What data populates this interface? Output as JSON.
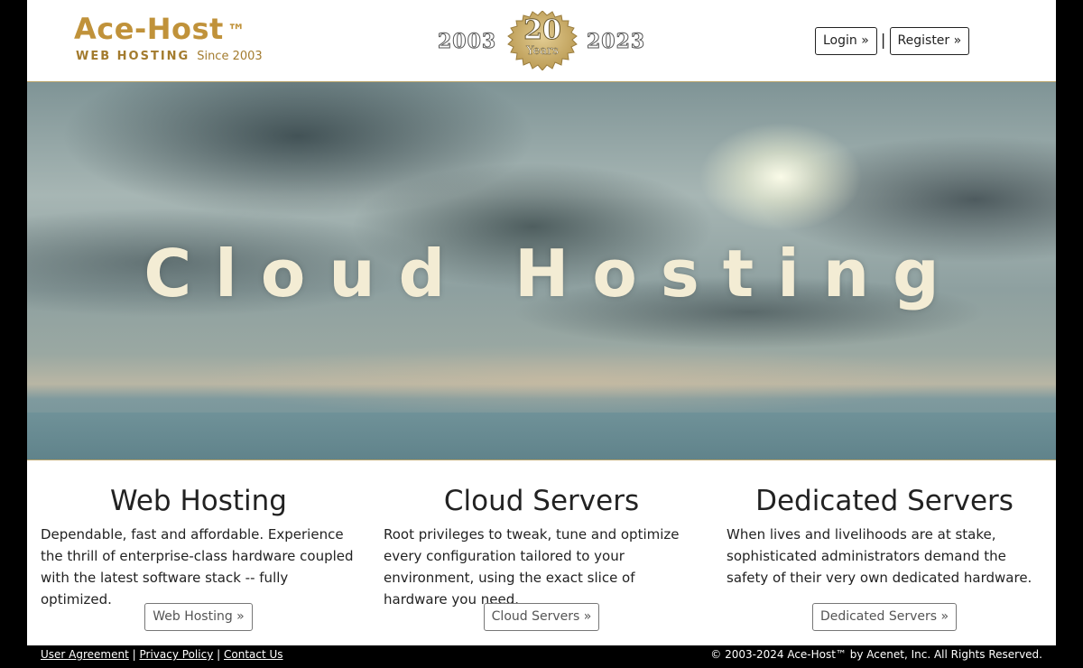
{
  "header": {
    "logo_title": "Ace-Host",
    "logo_tm": "™",
    "logo_tagline": "WEB HOSTING",
    "logo_since": "Since 2003",
    "anniversary": {
      "year_start": "2003",
      "year_end": "2023",
      "seal_number": "20",
      "seal_label": "Years"
    },
    "login_label": "Login »",
    "separator": "|",
    "register_label": "Register »"
  },
  "hero": {
    "title": "Cloud Hosting"
  },
  "features": [
    {
      "title": "Web Hosting",
      "description": "Dependable, fast and affordable. Experience the thrill of enterprise-class hardware coupled with the latest software stack -- fully optimized.",
      "button_label": "Web Hosting »"
    },
    {
      "title": "Cloud Servers",
      "description": "Root privileges to tweak, tune and optimize every configuration tailored to your environment, using the exact slice of hardware you need.",
      "button_label": "Cloud Servers »"
    },
    {
      "title": "Dedicated Servers",
      "description": "When lives and livelihoods are at stake, sophisticated administrators demand the safety of their very own dedicated hardware.",
      "button_label": "Dedicated Servers »"
    }
  ],
  "footer": {
    "links": [
      "User Agreement",
      "Privacy Policy",
      "Contact Us"
    ],
    "separator": "|",
    "copyright": "© 2003-2024 Ace-Host™ by Acenet, Inc. All Rights Reserved."
  },
  "colors": {
    "brand_gold": "#c0923a",
    "page_background": "#000000",
    "hero_text": "#f3ecd4"
  },
  "icons": {
    "seal": "anniversary-seal-icon"
  }
}
